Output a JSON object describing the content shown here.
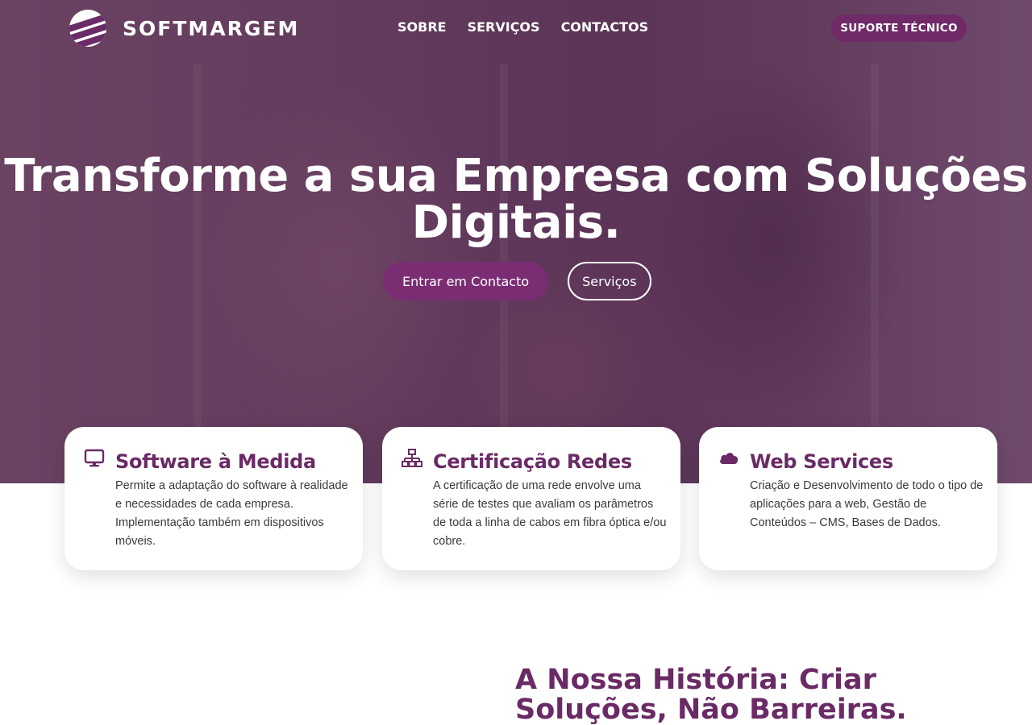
{
  "brand": {
    "name": "SOFTMARGEM",
    "accent": "#6f2a67"
  },
  "nav": {
    "links": [
      "SOBRE",
      "SERVIÇOS",
      "CONTACTOS"
    ],
    "support_label": "SUPORTE TÉCNICO"
  },
  "hero": {
    "title": "Transforme a sua Empresa com Soluções Digitais.",
    "primary_cta": "Entrar em Contacto",
    "secondary_cta": "Serviços"
  },
  "cards": [
    {
      "icon": "monitor-icon",
      "title": "Software à Medida",
      "text": "Permite a adaptação do software à realidade e necessidades de cada empresa. Implementação também em dispositivos móveis."
    },
    {
      "icon": "network-icon",
      "title": "Certificação Redes",
      "text": "A certificação de uma rede envolve uma série de testes que avaliam os parâmetros de toda a linha de cabos em fibra óptica e/ou cobre."
    },
    {
      "icon": "cloud-icon",
      "title": "Web Services",
      "text": "Criação e Desenvolvimento de todo o tipo de aplicações para a web, Gestão de Conteúdos – CMS, Bases de Dados."
    }
  ],
  "history": {
    "title": "A Nossa História: Criar Soluções, Não Barreiras."
  }
}
